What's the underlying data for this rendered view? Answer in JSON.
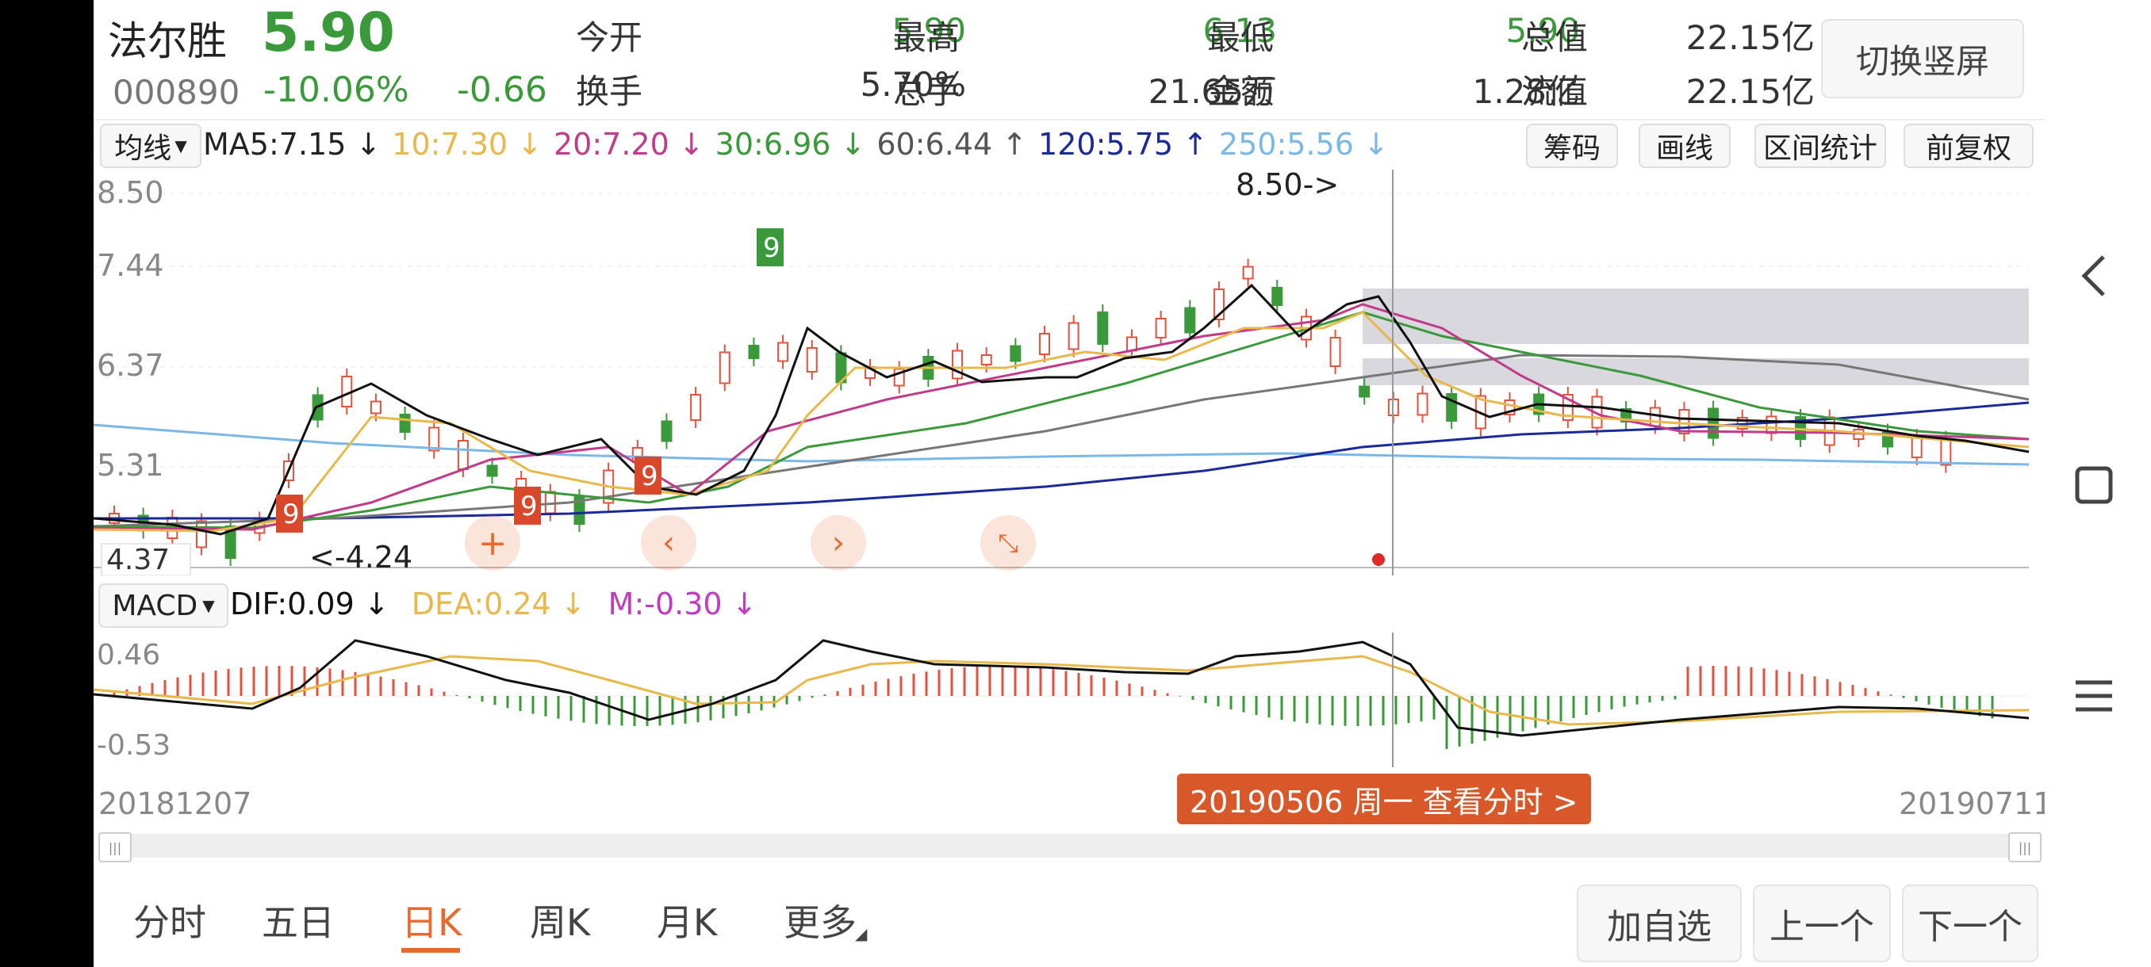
{
  "stock": {
    "name": "法尔胜",
    "price": "5.90",
    "code": "000890",
    "change_pct": "-10.06%",
    "change": "-0.66"
  },
  "quotes": [
    {
      "label": "今开",
      "value": "5.90",
      "value_color": "#3a9a3a"
    },
    {
      "label": "最高",
      "value": "6.13",
      "value_color": "#3a9a3a"
    },
    {
      "label": "最低",
      "value": "5.90",
      "value_color": "#3a9a3a"
    },
    {
      "label": "总值",
      "value": "22.15亿",
      "value_color": "#333333"
    },
    {
      "label": "换手",
      "value": "5.70%",
      "value_color": "#333333"
    },
    {
      "label": "总手",
      "value": "21.65万",
      "value_color": "#333333"
    },
    {
      "label": "金额",
      "value": "1.28亿",
      "value_color": "#333333"
    },
    {
      "label": "流值",
      "value": "22.15亿",
      "value_color": "#333333"
    }
  ],
  "switch_button": "切换竖屏",
  "ma_selector": "均线",
  "ma_values": [
    {
      "text": "MA5:7.15 ↓",
      "color": "#222222"
    },
    {
      "text": "10:7.30 ↓",
      "color": "#e8b84a"
    },
    {
      "text": "20:7.20 ↓",
      "color": "#c23a8a"
    },
    {
      "text": "30:6.96 ↓",
      "color": "#3a9a3a"
    },
    {
      "text": "60:6.44 ↑",
      "color": "#555555"
    },
    {
      "text": "120:5.75 ↑",
      "color": "#1a2a9a"
    },
    {
      "text": "250:5.56 ↓",
      "color": "#7ab8e8"
    }
  ],
  "chart_tools": [
    "筹码",
    "画线",
    "区间统计",
    "前复权"
  ],
  "main_chart": {
    "y_labels": [
      "8.50",
      "7.44",
      "6.37",
      "5.31"
    ],
    "low_label": "4.37",
    "high_marker": "8.50->",
    "low_marker": "<-4.24",
    "td_nine_badges": [
      "9",
      "9",
      "9",
      "9"
    ]
  },
  "macd": {
    "selector": "MACD",
    "dif": "DIF:0.09 ↓",
    "dea": "DEA:0.24 ↓",
    "m": "M:-0.30 ↓",
    "y_top": "0.46",
    "y_bottom": "-0.53"
  },
  "date_start": "20181207",
  "date_end": "20190711",
  "crosshair_label": "20190506 周一 查看分时 >",
  "period_tabs": [
    "分时",
    "五日",
    "日K",
    "周K",
    "月K",
    "更多"
  ],
  "active_tab": "日K",
  "bottom_buttons": [
    "加自选",
    "上一个",
    "下一个"
  ],
  "colors": {
    "up": "#e0533e",
    "down": "#3a9a3a",
    "accent": "#e8692b"
  },
  "icons": {
    "nav_back": "chevron-left-icon",
    "nav_home": "square-icon",
    "nav_menu": "menu-icon",
    "zoom_in": "plus-icon",
    "pan_left": "chevron-left-icon",
    "pan_right": "chevron-right-icon",
    "zoom_reset": "compress-icon"
  }
}
